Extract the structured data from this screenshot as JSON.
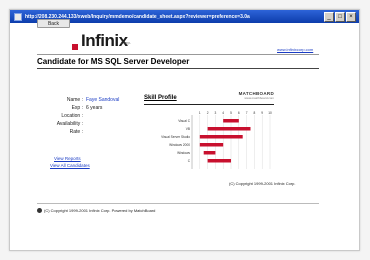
{
  "window": {
    "url": "http://208.230.244.133/xweb/Inquiry/mmdemo/candidate_sheet.aspx?reviewer=preference=3.0a"
  },
  "toolbar": {
    "back_label": "Back"
  },
  "brand": {
    "logo_text": "Infinix",
    "logo_sub": "Corp.",
    "site_link": "www.infinixcorp.com",
    "accent": "#c8102e"
  },
  "page": {
    "title": "Candidate for MS SQL Server Developer"
  },
  "candidate": {
    "rows": [
      {
        "label": "Name :",
        "value": "Faye Sandoval"
      },
      {
        "label": "Exp :",
        "value": "6 years"
      },
      {
        "label": "Location :",
        "value": ""
      },
      {
        "label": "Availability :",
        "value": ""
      },
      {
        "label": "Rate :",
        "value": ""
      }
    ]
  },
  "links": {
    "view_reports": "View Reports",
    "view_all": "View All Candidates"
  },
  "skill_panel": {
    "title": "Skill Profile",
    "brand": "MATCHBOARD",
    "brand_sub": "www.matchboard.com",
    "copyright": "(C) Copyright 1999-2001 Infinix Corp."
  },
  "chart_data": {
    "type": "bar",
    "orientation": "horizontal",
    "categories": [
      "Visual C",
      "VB",
      "Visual Server Studio",
      "Windows 2000",
      "Windows",
      "C"
    ],
    "xlim": [
      0,
      10
    ],
    "x_ticks": [
      "1",
      "2",
      "3",
      "4",
      "5",
      "6",
      "7",
      "8",
      "9",
      "10"
    ],
    "values": [
      [
        4.0,
        6.0
      ],
      [
        2.0,
        7.5
      ],
      [
        1.0,
        6.5
      ],
      [
        1.0,
        4.0
      ],
      [
        1.5,
        3.0
      ],
      [
        2.0,
        5.0
      ]
    ],
    "bar_color": "#c8102e",
    "grid": true
  },
  "footer": {
    "text": "(C) Copyright 1999-2001 Infinix Corp. Powered by MatchBoard"
  }
}
